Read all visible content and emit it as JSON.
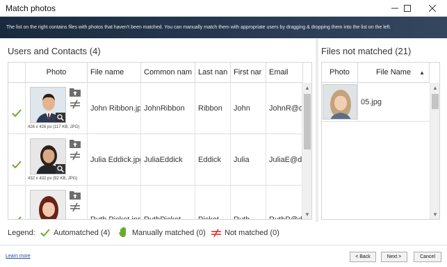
{
  "window": {
    "title": "Match photos",
    "minimize_icon": "minimize-icon",
    "maximize_icon": "maximize-icon",
    "close_icon": "close-icon"
  },
  "banner": {
    "text": "The list on the right contains files with photos that haven't been matched. You can manually match them with appropriate users by dragging & dropping them into the list on the left."
  },
  "users": {
    "title": "Users and Contacts (4)",
    "columns": [
      "",
      "Photo",
      "File name",
      "Common nam",
      "Last nan",
      "First nar",
      "Email"
    ],
    "sorted_column": "Common nam",
    "rows": [
      {
        "status_icon": "check-icon",
        "photo_caption": "426 x 426 px (117 KB, JPG)",
        "file_name": "John Ribbon.jpg",
        "common_name": "JohnRibbon",
        "last_name": "Ribbon",
        "first_name": "John",
        "email": "JohnR@ds"
      },
      {
        "status_icon": "check-icon",
        "photo_caption": "432 x 432 px (92 KB, JPG)",
        "file_name": "Julia Eddick.jpg",
        "common_name": "JuliaEddick",
        "last_name": "Eddick",
        "first_name": "Julia",
        "email": "JuliaE@ds"
      },
      {
        "status_icon": "check-icon",
        "photo_caption": "",
        "file_name": "Ruth Picket.jpg",
        "common_name": "RuthPicket",
        "last_name": "Picket",
        "first_name": "Ruth",
        "email": "RuthP@ds"
      }
    ]
  },
  "files": {
    "title": "Files not matched (21)",
    "columns": [
      "Photo",
      "File Name"
    ],
    "sorted_column": "File Name",
    "rows": [
      {
        "file_name": "05.jpg"
      }
    ]
  },
  "legend": {
    "label": "Legend:",
    "automatched": "Automatched (4)",
    "manually": "Manually matched (0)",
    "not_matched": "Not matched (0)"
  },
  "footer": {
    "learn_more": "Learn more",
    "back": "< Back",
    "next": "Next >",
    "cancel": "Cancel"
  },
  "colors": {
    "check": "#6aab2e",
    "not_matched": "#e0302f",
    "banner": "#22344a"
  }
}
